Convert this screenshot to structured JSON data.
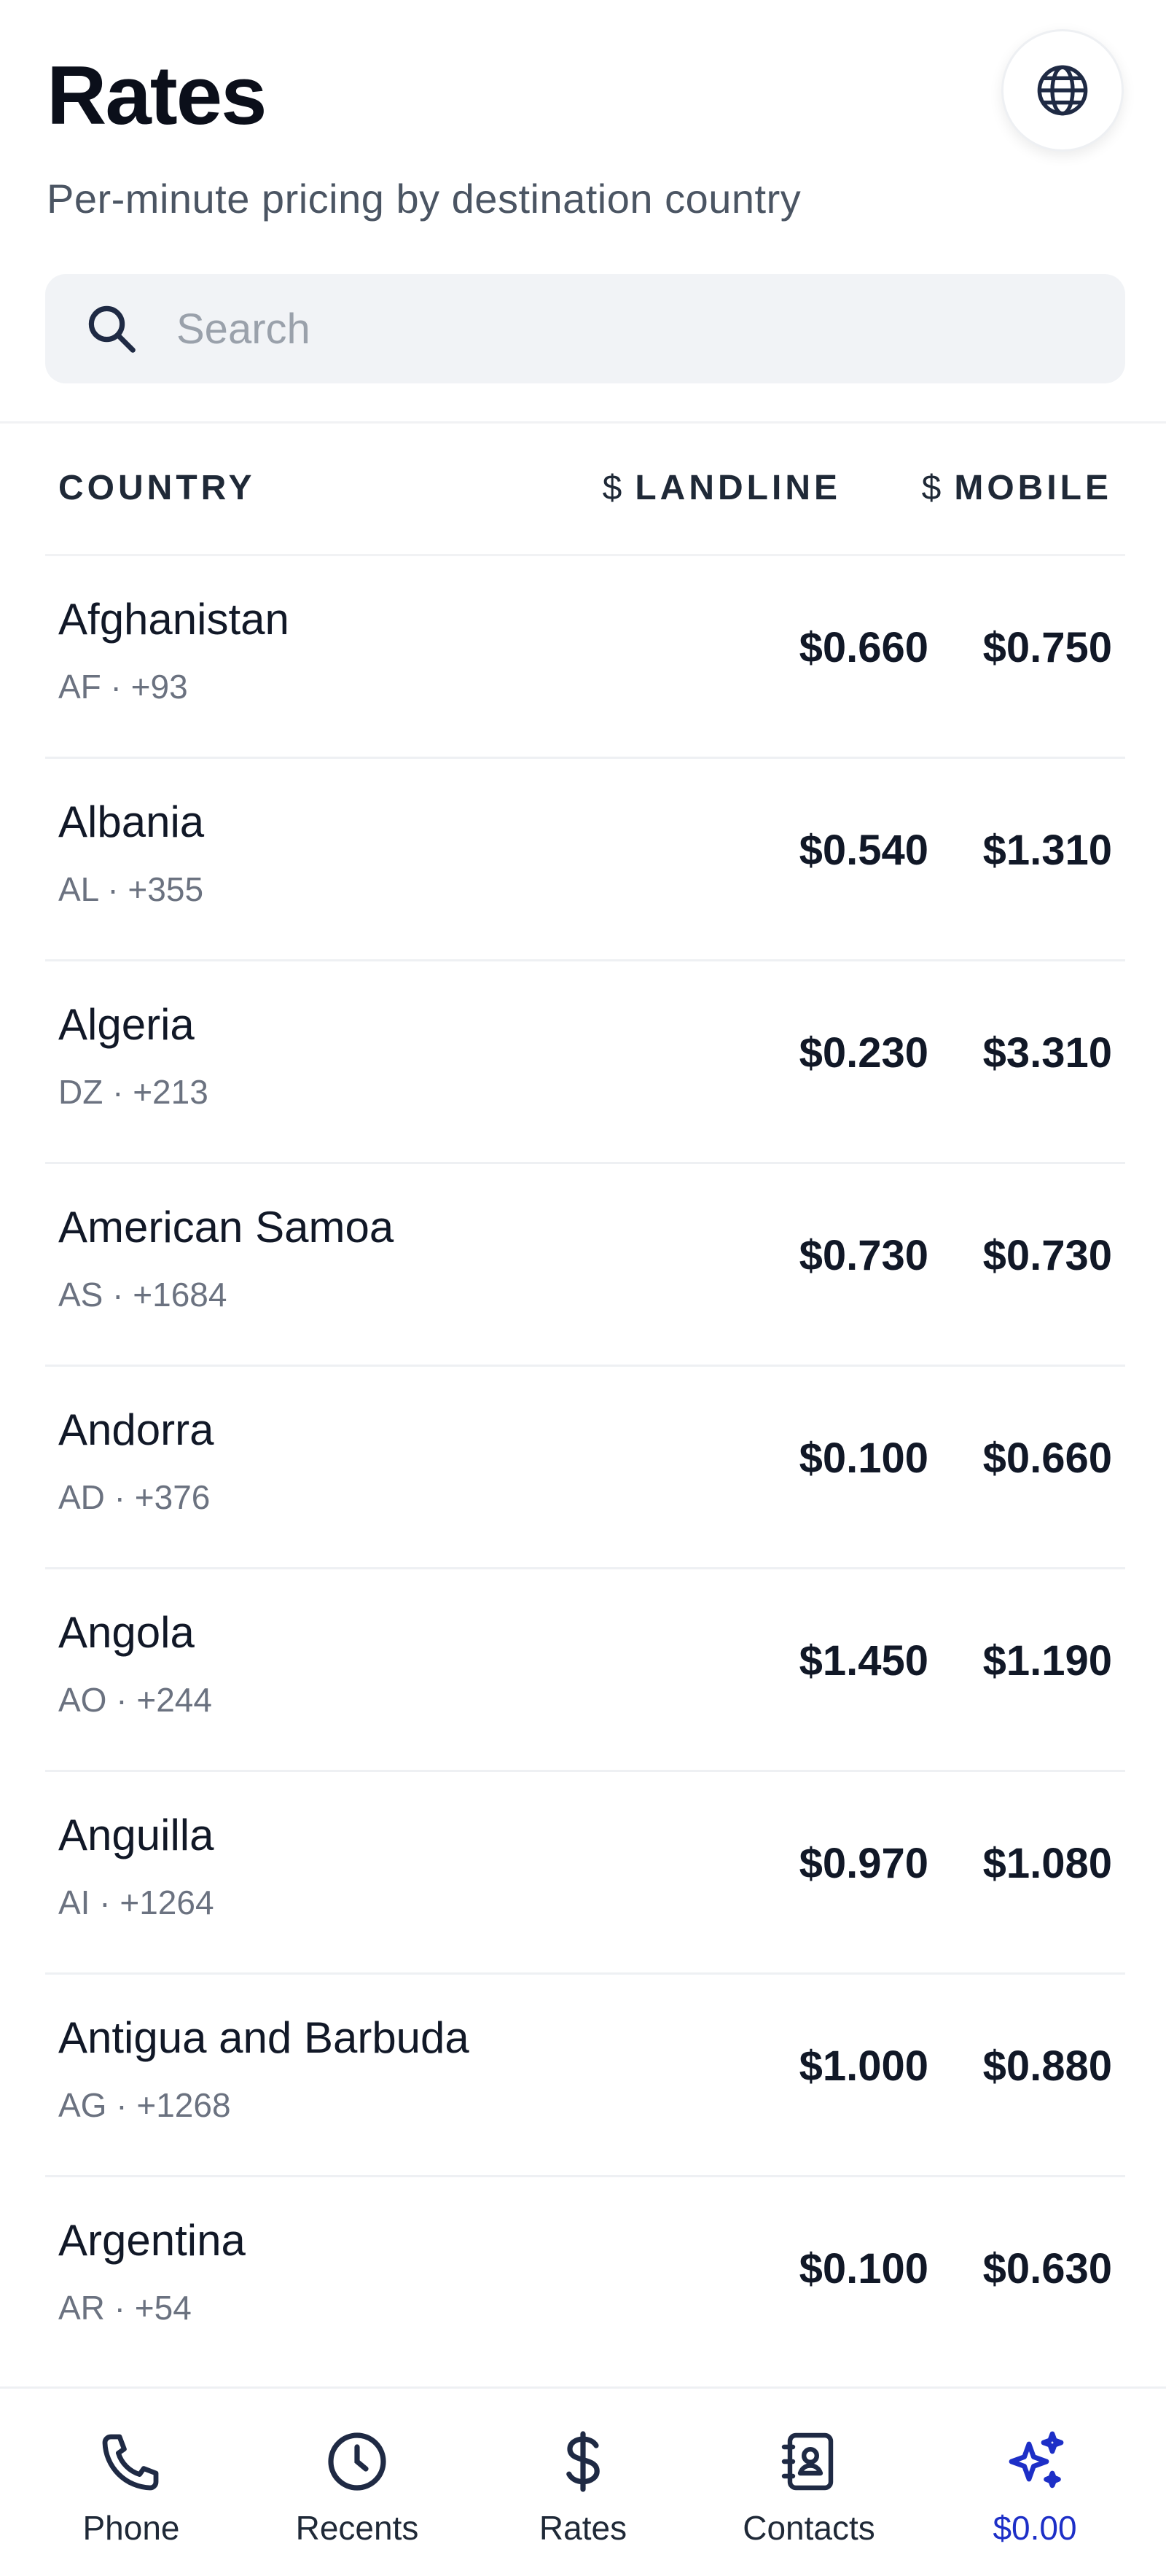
{
  "header": {
    "title": "Rates",
    "subtitle": "Per-minute pricing by destination country",
    "globe_icon": "globe-icon"
  },
  "search": {
    "placeholder": "Search",
    "value": ""
  },
  "table": {
    "columns": {
      "country": "COUNTRY",
      "currency_symbol": "$",
      "landline": "LANDLINE",
      "mobile": "MOBILE"
    },
    "rows": [
      {
        "name": "Afghanistan",
        "meta": "AF · +93",
        "landline": "$0.660",
        "mobile": "$0.750"
      },
      {
        "name": "Albania",
        "meta": "AL · +355",
        "landline": "$0.540",
        "mobile": "$1.310"
      },
      {
        "name": "Algeria",
        "meta": "DZ · +213",
        "landline": "$0.230",
        "mobile": "$3.310"
      },
      {
        "name": "American Samoa",
        "meta": "AS · +1684",
        "landline": "$0.730",
        "mobile": "$0.730"
      },
      {
        "name": "Andorra",
        "meta": "AD · +376",
        "landline": "$0.100",
        "mobile": "$0.660"
      },
      {
        "name": "Angola",
        "meta": "AO · +244",
        "landline": "$1.450",
        "mobile": "$1.190"
      },
      {
        "name": "Anguilla",
        "meta": "AI · +1264",
        "landline": "$0.970",
        "mobile": "$1.080"
      },
      {
        "name": "Antigua and Barbuda",
        "meta": "AG · +1268",
        "landline": "$1.000",
        "mobile": "$0.880"
      },
      {
        "name": "Argentina",
        "meta": "AR · +54",
        "landline": "$0.100",
        "mobile": "$0.630"
      }
    ]
  },
  "nav": {
    "items": [
      {
        "label": "Phone",
        "icon": "phone-icon"
      },
      {
        "label": "Recents",
        "icon": "clock-icon"
      },
      {
        "label": "Rates",
        "icon": "dollar-icon"
      },
      {
        "label": "Contacts",
        "icon": "contacts-icon"
      },
      {
        "label": "$0.00",
        "icon": "sparkles-icon",
        "active": true
      }
    ]
  },
  "colors": {
    "accent": "#1d2fc7",
    "text": "#111827",
    "muted": "#6b7280",
    "search_bg": "#f1f3f6"
  }
}
